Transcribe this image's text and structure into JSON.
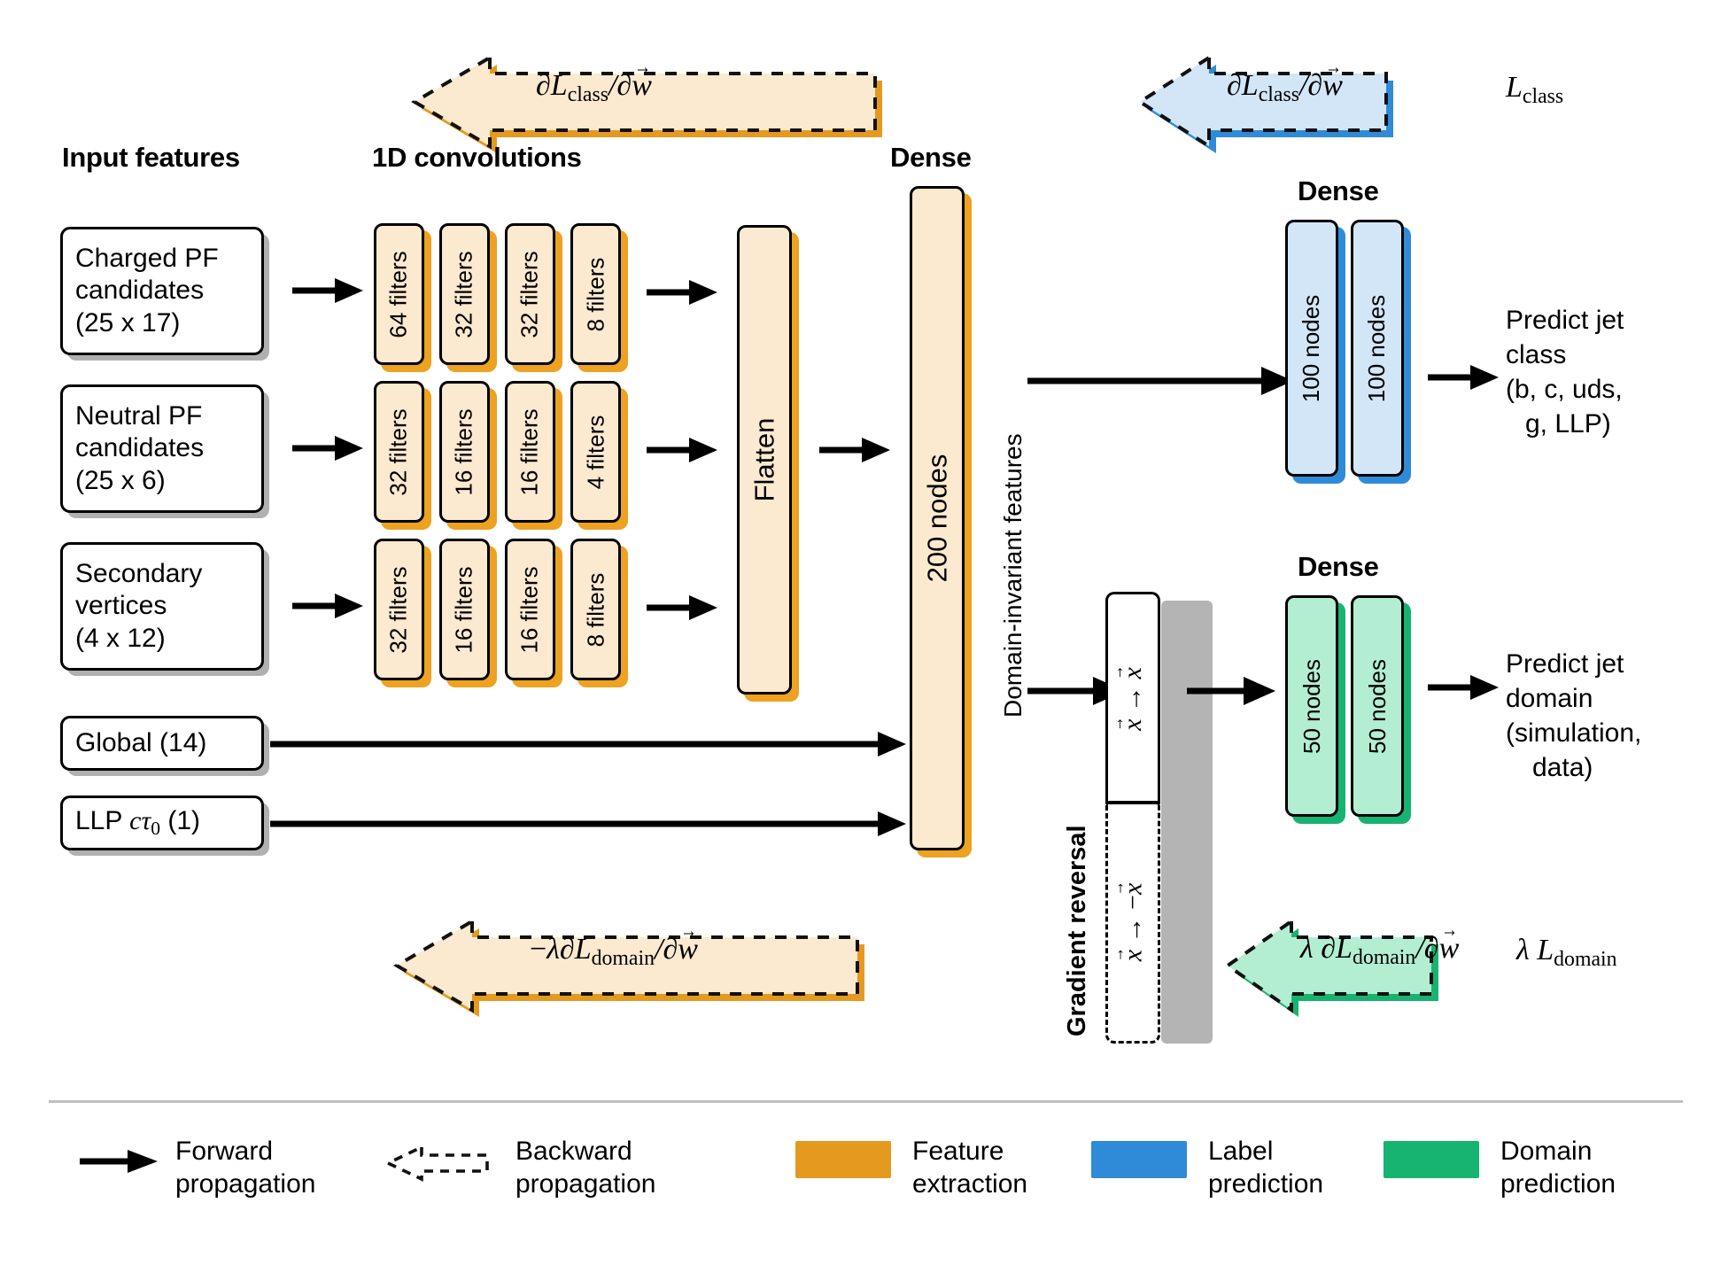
{
  "headers": {
    "input_features": "Input features",
    "conv": "1D convolutions",
    "dense_main": "Dense",
    "dense_class": "Dense",
    "dense_domain": "Dense"
  },
  "inputs": [
    {
      "name": "charged-pf",
      "lines": [
        "Charged PF",
        "candidates",
        "(25 x 17)"
      ]
    },
    {
      "name": "neutral-pf",
      "lines": [
        "Neutral PF",
        "candidates",
        "(25 x 6)"
      ]
    },
    {
      "name": "secondary-vertices",
      "lines": [
        "Secondary",
        "vertices",
        "(4 x 12)"
      ]
    },
    {
      "name": "global",
      "lines": [
        "Global (14)"
      ]
    },
    {
      "name": "llp-ctau",
      "lines": [
        "LLP cτ₀ (1)"
      ]
    }
  ],
  "conv_rows": [
    {
      "row": "charged",
      "blocks": [
        "64 filters",
        "32 filters",
        "32 filters",
        "8 filters"
      ]
    },
    {
      "row": "neutral",
      "blocks": [
        "32 filters",
        "16 filters",
        "16 filters",
        "4 filters"
      ]
    },
    {
      "row": "vertices",
      "blocks": [
        "32 filters",
        "16 filters",
        "16 filters",
        "8 filters"
      ]
    }
  ],
  "flatten": {
    "label": "Flatten"
  },
  "dense_main": {
    "label": "200 nodes"
  },
  "domain_invariant_label": "Domain-invariant features",
  "class_branch": {
    "blocks": [
      "100 nodes",
      "100 nodes"
    ],
    "output_lines": [
      "Predict jet",
      "class",
      "(b, c, uds,",
      "g, LLP)"
    ]
  },
  "domain_branch": {
    "blocks": [
      "50 nodes",
      "50 nodes"
    ],
    "output_lines": [
      "Predict jet",
      "domain",
      "(simulation,",
      "data)"
    ]
  },
  "gradient_reversal": {
    "label": "Gradient reversal",
    "forward_expr": "x⃗ → x⃗",
    "backward_expr": "x⃗ → −x⃗"
  },
  "backward_arrows": {
    "feature_class": "∂L_class/∂w⃗",
    "label_class": "∂L_class/∂w⃗",
    "loss_class": "L_class",
    "feature_domain": "−λ ∂L_domain/∂w⃗",
    "domain_grad": "λ ∂L_domain/∂w⃗",
    "loss_domain": "λ L_domain"
  },
  "legend": [
    {
      "name": "forward-propagation",
      "icon": "solid-arrow-icon",
      "lines": [
        "Forward",
        "propagation"
      ]
    },
    {
      "name": "backward-propagation",
      "icon": "dashed-arrow-icon",
      "lines": [
        "Backward",
        "propagation"
      ]
    },
    {
      "name": "feature-extraction",
      "icon": "color-swatch",
      "color": "#e59a1f",
      "lines": [
        "Feature",
        "extraction"
      ]
    },
    {
      "name": "label-prediction",
      "icon": "color-swatch",
      "color": "#2f8bd8",
      "lines": [
        "Label",
        "prediction"
      ]
    },
    {
      "name": "domain-prediction",
      "icon": "color-swatch",
      "color": "#17b471",
      "lines": [
        "Domain",
        "prediction"
      ]
    }
  ],
  "colors": {
    "feature_fill": "#fbe9d0",
    "feature_accent": "#e59a1f",
    "label_fill": "#d3e6f8",
    "label_accent": "#2f8bd8",
    "domain_fill": "#b3eed2",
    "domain_accent": "#17b471"
  }
}
